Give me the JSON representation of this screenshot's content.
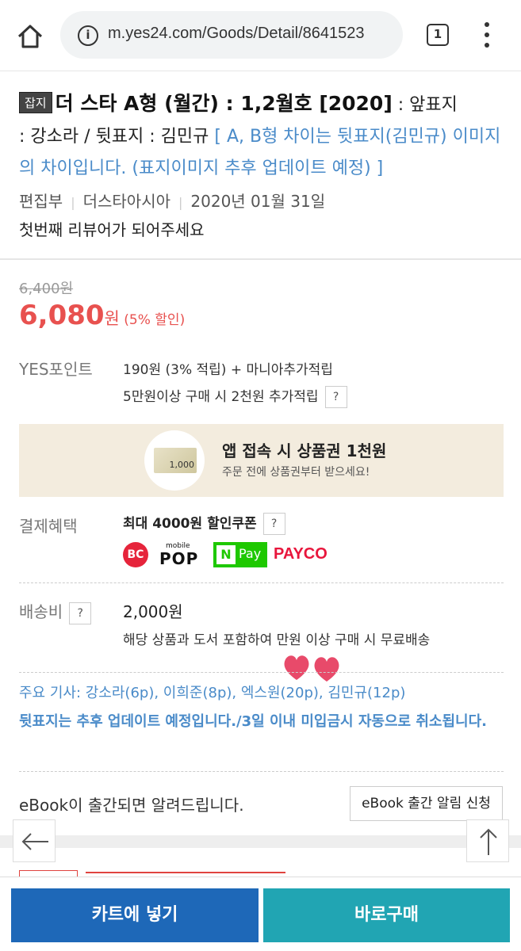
{
  "browser": {
    "url": "m.yes24.com/Goods/Detail/8641523",
    "tab_count": "1"
  },
  "product": {
    "badge": "잡지",
    "title": "더 스타 A형 (월간) : 1,2월호 [2020]",
    "subtitle_part1": " : 앞표지",
    "subtitle_part2": ": 강소라 / 뒷표지 : 김민규",
    "note": " [ A, B형 차이는 뒷표지(김민규) 이미지의 차이입니다. (표지이미지 추후 업데이트 예정) ]",
    "publisher_label": "편집부",
    "publisher": "더스타아시아",
    "date": "2020년 01월 31일",
    "review_prompt": "첫번째 리뷰어가 되어주세요"
  },
  "price": {
    "original": "6,400원",
    "sale_amount": "6,080",
    "sale_unit": "원",
    "discount": " (5% 할인)"
  },
  "points": {
    "label": "YES포인트",
    "line1": "190원 (3% 적립) + 마니아추가적립",
    "line2": "5만원이상 구매 시 2천원 추가적립",
    "help": "?"
  },
  "banner": {
    "voucher_value": "1,000",
    "title": "앱 접속 시 상품권 1천원",
    "subtitle": "주문 전에 상품권부터 받으세요!"
  },
  "payment": {
    "label": "결제혜택",
    "coupon": "최대 4000원 할인쿠폰",
    "help": "?",
    "logos": {
      "bc": "BC",
      "pop_small": "mobile",
      "pop_big": "POP",
      "npay_n": "N",
      "npay_pay": "Pay",
      "payco": "PAYCO"
    }
  },
  "shipping": {
    "label": "배송비",
    "help": "?",
    "fee": "2,000원",
    "note": "해당 상품과 도서 포함하여 만원 이상 구매 시 무료배송"
  },
  "articles": "주요 기사: 강소라(6p), 이희준(8p), 엑스원(20p), 김민규(12p)",
  "notice": "뒷표지는 추후 업데이트 예정입니다./3일 이내 미입금시 자동으로 취소됩니다.",
  "ebook": {
    "text": "eBook이 출간되면 알려드립니다.",
    "button": "eBook 출간 알림 신청"
  },
  "footer": {
    "cart": "카트에 넣기",
    "buy": "바로구매"
  },
  "colors": {
    "sale_red": "#e8514f",
    "link_blue": "#4a8bc9",
    "cart_blue": "#1e68b8",
    "buy_teal": "#21a5b3",
    "banner_bg": "#f3ecde"
  }
}
